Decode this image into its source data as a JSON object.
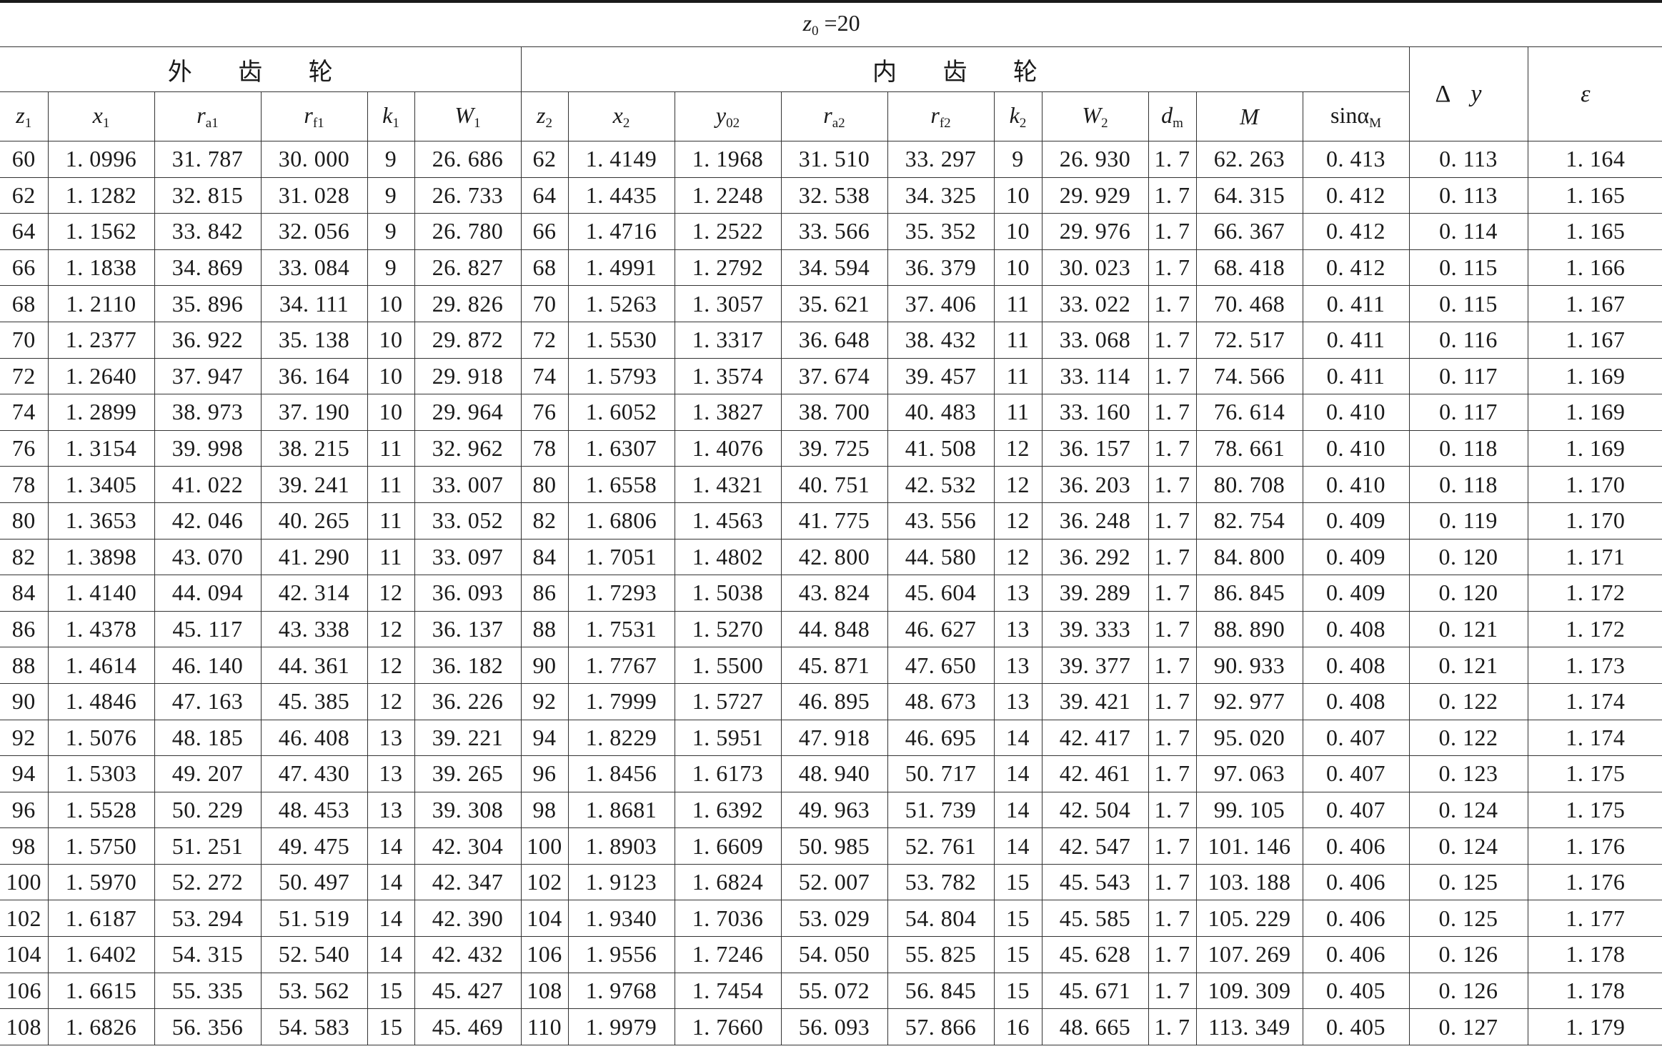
{
  "title": {
    "var": "z",
    "sub": "0",
    "rest": " =20"
  },
  "groups": {
    "external": "外 齿 轮",
    "internal": "内 齿 轮"
  },
  "columns": {
    "dy": {
      "pre": "Δ",
      "var": "y"
    },
    "eps": {
      "var": "ε"
    },
    "z1": {
      "var": "z",
      "sub": "1"
    },
    "x1": {
      "var": "x",
      "sub": "1"
    },
    "ra1": {
      "var": "r",
      "sub": "a1"
    },
    "rf1": {
      "var": "r",
      "sub": "f1"
    },
    "k1": {
      "var": "k",
      "sub": "1"
    },
    "W1": {
      "var": "W",
      "sub": "1"
    },
    "z2": {
      "var": "z",
      "sub": "2"
    },
    "x2": {
      "var": "x",
      "sub": "2"
    },
    "y02": {
      "var": "y",
      "sub": "02"
    },
    "ra2": {
      "var": "r",
      "sub": "a2"
    },
    "rf2": {
      "var": "r",
      "sub": "f2"
    },
    "k2": {
      "var": "k",
      "sub": "2"
    },
    "W2": {
      "var": "W",
      "sub": "2"
    },
    "dm": {
      "var": "d",
      "sub": "m"
    },
    "M": {
      "var": "M"
    },
    "sin": {
      "text": "sinα",
      "sub": "M"
    }
  },
  "rows": [
    [
      "60",
      "1. 0996",
      "31. 787",
      "30. 000",
      "9",
      "26. 686",
      "62",
      "1. 4149",
      "1. 1968",
      "31. 510",
      "33. 297",
      "9",
      "26. 930",
      "1. 7",
      "62. 263",
      "0. 413",
      "0. 113",
      "1. 164"
    ],
    [
      "62",
      "1. 1282",
      "32. 815",
      "31. 028",
      "9",
      "26. 733",
      "64",
      "1. 4435",
      "1. 2248",
      "32. 538",
      "34. 325",
      "10",
      "29. 929",
      "1. 7",
      "64. 315",
      "0. 412",
      "0. 113",
      "1. 165"
    ],
    [
      "64",
      "1. 1562",
      "33. 842",
      "32. 056",
      "9",
      "26. 780",
      "66",
      "1. 4716",
      "1. 2522",
      "33. 566",
      "35. 352",
      "10",
      "29. 976",
      "1. 7",
      "66. 367",
      "0. 412",
      "0. 114",
      "1. 165"
    ],
    [
      "66",
      "1. 1838",
      "34. 869",
      "33. 084",
      "9",
      "26. 827",
      "68",
      "1. 4991",
      "1. 2792",
      "34. 594",
      "36. 379",
      "10",
      "30. 023",
      "1. 7",
      "68. 418",
      "0. 412",
      "0. 115",
      "1. 166"
    ],
    [
      "68",
      "1. 2110",
      "35. 896",
      "34. 111",
      "10",
      "29. 826",
      "70",
      "1. 5263",
      "1. 3057",
      "35. 621",
      "37. 406",
      "11",
      "33. 022",
      "1. 7",
      "70. 468",
      "0. 411",
      "0. 115",
      "1. 167"
    ],
    [
      "70",
      "1. 2377",
      "36. 922",
      "35. 138",
      "10",
      "29. 872",
      "72",
      "1. 5530",
      "1. 3317",
      "36. 648",
      "38. 432",
      "11",
      "33. 068",
      "1. 7",
      "72. 517",
      "0. 411",
      "0. 116",
      "1. 167"
    ],
    [
      "72",
      "1. 2640",
      "37. 947",
      "36. 164",
      "10",
      "29. 918",
      "74",
      "1. 5793",
      "1. 3574",
      "37. 674",
      "39. 457",
      "11",
      "33. 114",
      "1. 7",
      "74. 566",
      "0. 411",
      "0. 117",
      "1. 169"
    ],
    [
      "74",
      "1. 2899",
      "38. 973",
      "37. 190",
      "10",
      "29. 964",
      "76",
      "1. 6052",
      "1. 3827",
      "38. 700",
      "40. 483",
      "11",
      "33. 160",
      "1. 7",
      "76. 614",
      "0. 410",
      "0. 117",
      "1. 169"
    ],
    [
      "76",
      "1. 3154",
      "39. 998",
      "38. 215",
      "11",
      "32. 962",
      "78",
      "1. 6307",
      "1. 4076",
      "39. 725",
      "41. 508",
      "12",
      "36. 157",
      "1. 7",
      "78. 661",
      "0. 410",
      "0. 118",
      "1. 169"
    ],
    [
      "78",
      "1. 3405",
      "41. 022",
      "39. 241",
      "11",
      "33. 007",
      "80",
      "1. 6558",
      "1. 4321",
      "40. 751",
      "42. 532",
      "12",
      "36. 203",
      "1. 7",
      "80. 708",
      "0. 410",
      "0. 118",
      "1. 170"
    ],
    [
      "80",
      "1. 3653",
      "42. 046",
      "40. 265",
      "11",
      "33. 052",
      "82",
      "1. 6806",
      "1. 4563",
      "41. 775",
      "43. 556",
      "12",
      "36. 248",
      "1. 7",
      "82. 754",
      "0. 409",
      "0. 119",
      "1. 170"
    ],
    [
      "82",
      "1. 3898",
      "43. 070",
      "41. 290",
      "11",
      "33. 097",
      "84",
      "1. 7051",
      "1. 4802",
      "42. 800",
      "44. 580",
      "12",
      "36. 292",
      "1. 7",
      "84. 800",
      "0. 409",
      "0. 120",
      "1. 171"
    ],
    [
      "84",
      "1. 4140",
      "44. 094",
      "42. 314",
      "12",
      "36. 093",
      "86",
      "1. 7293",
      "1. 5038",
      "43. 824",
      "45. 604",
      "13",
      "39. 289",
      "1. 7",
      "86. 845",
      "0. 409",
      "0. 120",
      "1. 172"
    ],
    [
      "86",
      "1. 4378",
      "45. 117",
      "43. 338",
      "12",
      "36. 137",
      "88",
      "1. 7531",
      "1. 5270",
      "44. 848",
      "46. 627",
      "13",
      "39. 333",
      "1. 7",
      "88. 890",
      "0. 408",
      "0. 121",
      "1. 172"
    ],
    [
      "88",
      "1. 4614",
      "46. 140",
      "44. 361",
      "12",
      "36. 182",
      "90",
      "1. 7767",
      "1. 5500",
      "45. 871",
      "47. 650",
      "13",
      "39. 377",
      "1. 7",
      "90. 933",
      "0. 408",
      "0. 121",
      "1. 173"
    ],
    [
      "90",
      "1. 4846",
      "47. 163",
      "45. 385",
      "12",
      "36. 226",
      "92",
      "1. 7999",
      "1. 5727",
      "46. 895",
      "48. 673",
      "13",
      "39. 421",
      "1. 7",
      "92. 977",
      "0. 408",
      "0. 122",
      "1. 174"
    ],
    [
      "92",
      "1. 5076",
      "48. 185",
      "46. 408",
      "13",
      "39. 221",
      "94",
      "1. 8229",
      "1. 5951",
      "47. 918",
      "46. 695",
      "14",
      "42. 417",
      "1. 7",
      "95. 020",
      "0. 407",
      "0. 122",
      "1. 174"
    ],
    [
      "94",
      "1. 5303",
      "49. 207",
      "47. 430",
      "13",
      "39. 265",
      "96",
      "1. 8456",
      "1. 6173",
      "48. 940",
      "50. 717",
      "14",
      "42. 461",
      "1. 7",
      "97. 063",
      "0. 407",
      "0. 123",
      "1. 175"
    ],
    [
      "96",
      "1. 5528",
      "50. 229",
      "48. 453",
      "13",
      "39. 308",
      "98",
      "1. 8681",
      "1. 6392",
      "49. 963",
      "51. 739",
      "14",
      "42. 504",
      "1. 7",
      "99. 105",
      "0. 407",
      "0. 124",
      "1. 175"
    ],
    [
      "98",
      "1. 5750",
      "51. 251",
      "49. 475",
      "14",
      "42. 304",
      "100",
      "1. 8903",
      "1. 6609",
      "50. 985",
      "52. 761",
      "14",
      "42. 547",
      "1. 7",
      "101. 146",
      "0. 406",
      "0. 124",
      "1. 176"
    ],
    [
      "100",
      "1. 5970",
      "52. 272",
      "50. 497",
      "14",
      "42. 347",
      "102",
      "1. 9123",
      "1. 6824",
      "52. 007",
      "53. 782",
      "15",
      "45. 543",
      "1. 7",
      "103. 188",
      "0. 406",
      "0. 125",
      "1. 176"
    ],
    [
      "102",
      "1. 6187",
      "53. 294",
      "51. 519",
      "14",
      "42. 390",
      "104",
      "1. 9340",
      "1. 7036",
      "53. 029",
      "54. 804",
      "15",
      "45. 585",
      "1. 7",
      "105. 229",
      "0. 406",
      "0. 125",
      "1. 177"
    ],
    [
      "104",
      "1. 6402",
      "54. 315",
      "52. 540",
      "14",
      "42. 432",
      "106",
      "1. 9556",
      "1. 7246",
      "54. 050",
      "55. 825",
      "15",
      "45. 628",
      "1. 7",
      "107. 269",
      "0. 406",
      "0. 126",
      "1. 178"
    ],
    [
      "106",
      "1. 6615",
      "55. 335",
      "53. 562",
      "15",
      "45. 427",
      "108",
      "1. 9768",
      "1. 7454",
      "55. 072",
      "56. 845",
      "15",
      "45. 671",
      "1. 7",
      "109. 309",
      "0. 405",
      "0. 126",
      "1. 178"
    ],
    [
      "108",
      "1. 6826",
      "56. 356",
      "54. 583",
      "15",
      "45. 469",
      "110",
      "1. 9979",
      "1. 7660",
      "56. 093",
      "57. 866",
      "16",
      "48. 665",
      "1. 7",
      "113. 349",
      "0. 405",
      "0. 127",
      "1. 179"
    ]
  ]
}
